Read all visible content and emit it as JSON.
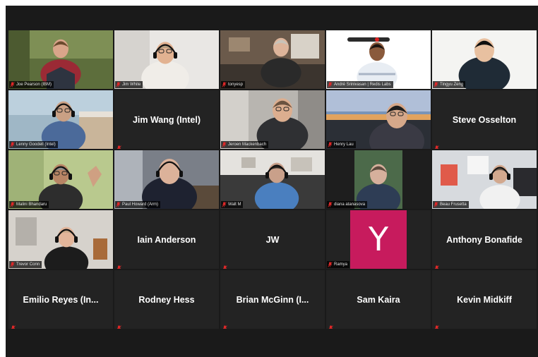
{
  "meeting": {
    "participants": [
      {
        "name": "Joe Pearson (IBM)",
        "kind": "video",
        "scene": "joe"
      },
      {
        "name": "Jim White",
        "kind": "video",
        "scene": "jimwhite"
      },
      {
        "name": "tonyesp",
        "kind": "video",
        "scene": "tony"
      },
      {
        "name": "André Srinivasan | Redis Labs",
        "kind": "video",
        "scene": "andre"
      },
      {
        "name": "Tingyu Zeng",
        "kind": "video",
        "scene": "tingyu"
      },
      {
        "name": "Lenny Goodell (Intel)",
        "kind": "video",
        "scene": "lenny"
      },
      {
        "name": "Jim Wang (Intel)",
        "kind": "name"
      },
      {
        "name": "Jeroen Mackenbach",
        "kind": "video",
        "scene": "jeroen"
      },
      {
        "name": "Henry Lau",
        "kind": "video",
        "scene": "henry",
        "active": true
      },
      {
        "name": "Steve Osselton",
        "kind": "name"
      },
      {
        "name": "Malini Bhandaru",
        "kind": "video",
        "scene": "malini"
      },
      {
        "name": "Paul Howard (Arm)",
        "kind": "video",
        "scene": "paul"
      },
      {
        "name": "Walt M",
        "kind": "video",
        "scene": "walt"
      },
      {
        "name": "diana atanasova",
        "kind": "video",
        "scene": "diana"
      },
      {
        "name": "Beau Frusetta",
        "kind": "video",
        "scene": "beau"
      },
      {
        "name": "Trevor Conn",
        "kind": "video",
        "scene": "trevor"
      },
      {
        "name": "Iain Anderson",
        "kind": "name"
      },
      {
        "name": "JW",
        "kind": "name"
      },
      {
        "name": "Ramya",
        "kind": "avatar",
        "initial": "Y",
        "avatar_color": "#c71b5d"
      },
      {
        "name": "Anthony Bonafide",
        "kind": "name"
      },
      {
        "name": "Emilio Reyes (In...",
        "kind": "name"
      },
      {
        "name": "Rodney Hess",
        "kind": "name"
      },
      {
        "name": "Brian McGinn (I...",
        "kind": "name"
      },
      {
        "name": "Sam Kaira",
        "kind": "name"
      },
      {
        "name": "Kevin Midkiff",
        "kind": "name"
      }
    ]
  },
  "icons": {
    "muted": "mic-muted-icon"
  },
  "colors": {
    "background": "#1a1a1a",
    "tile": "#232323",
    "active_speaker": "#d9e62c",
    "muted_icon": "#e02828"
  }
}
